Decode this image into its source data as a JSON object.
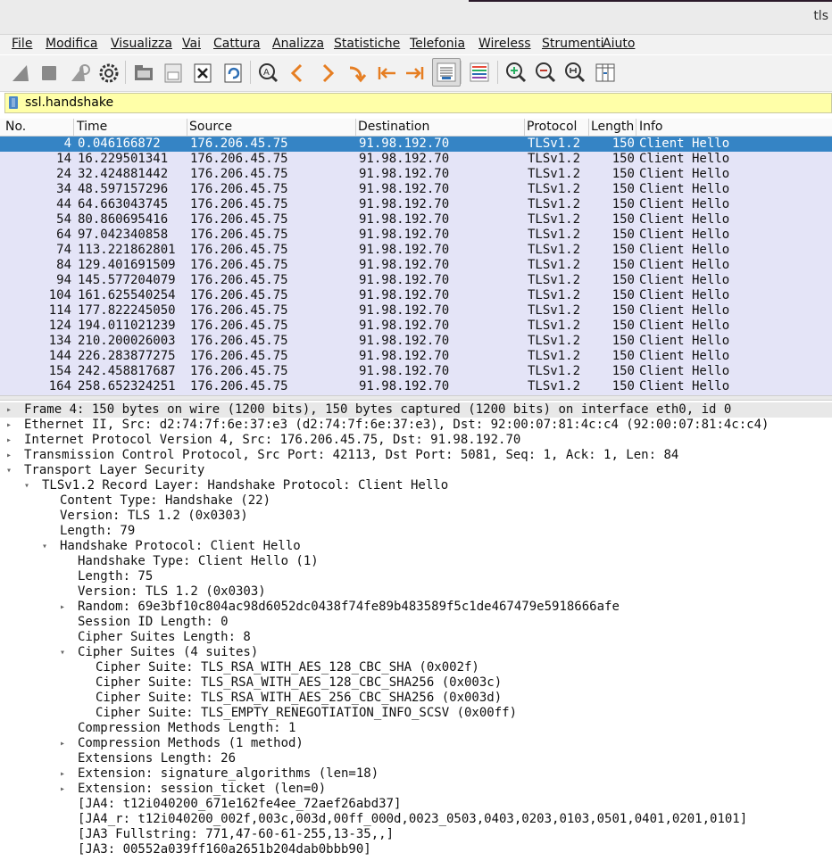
{
  "window": {
    "title": "tls"
  },
  "menu": [
    "File",
    "Modifica",
    "Visualizza",
    "Vai",
    "Cattura",
    "Analizza",
    "Statistiche",
    "Telefonia",
    "Wireless",
    "Strumenti",
    "Aiuto"
  ],
  "toolbar": {
    "icons": [
      "shark-fin-start-icon",
      "stop-square-icon",
      "shark-fin-restart-icon",
      "gear-options-icon",
      "folder-open-icon",
      "file-save-icon",
      "file-close-icon",
      "reload-icon",
      "find-packet-icon",
      "go-back-icon",
      "go-forward-icon",
      "go-to-packet-icon",
      "first-packet-icon",
      "last-packet-icon",
      "autoscroll-icon",
      "colorize-icon",
      "zoom-in-icon",
      "zoom-out-icon",
      "zoom-reset-icon",
      "resize-columns-icon"
    ]
  },
  "filter": {
    "value": "ssl.handshake"
  },
  "packet_list": {
    "columns": [
      "No.",
      "Time",
      "Source",
      "Destination",
      "Protocol",
      "Length",
      "Info"
    ],
    "rows": [
      {
        "no": "4",
        "time": "0.046166872",
        "source": "176.206.45.75",
        "destination": "91.98.192.70",
        "protocol": "TLSv1.2",
        "length": "150",
        "info": "Client Hello"
      },
      {
        "no": "14",
        "time": "16.229501341",
        "source": "176.206.45.75",
        "destination": "91.98.192.70",
        "protocol": "TLSv1.2",
        "length": "150",
        "info": "Client Hello"
      },
      {
        "no": "24",
        "time": "32.424881442",
        "source": "176.206.45.75",
        "destination": "91.98.192.70",
        "protocol": "TLSv1.2",
        "length": "150",
        "info": "Client Hello"
      },
      {
        "no": "34",
        "time": "48.597157296",
        "source": "176.206.45.75",
        "destination": "91.98.192.70",
        "protocol": "TLSv1.2",
        "length": "150",
        "info": "Client Hello"
      },
      {
        "no": "44",
        "time": "64.663043745",
        "source": "176.206.45.75",
        "destination": "91.98.192.70",
        "protocol": "TLSv1.2",
        "length": "150",
        "info": "Client Hello"
      },
      {
        "no": "54",
        "time": "80.860695416",
        "source": "176.206.45.75",
        "destination": "91.98.192.70",
        "protocol": "TLSv1.2",
        "length": "150",
        "info": "Client Hello"
      },
      {
        "no": "64",
        "time": "97.042340858",
        "source": "176.206.45.75",
        "destination": "91.98.192.70",
        "protocol": "TLSv1.2",
        "length": "150",
        "info": "Client Hello"
      },
      {
        "no": "74",
        "time": "113.221862801",
        "source": "176.206.45.75",
        "destination": "91.98.192.70",
        "protocol": "TLSv1.2",
        "length": "150",
        "info": "Client Hello"
      },
      {
        "no": "84",
        "time": "129.401691509",
        "source": "176.206.45.75",
        "destination": "91.98.192.70",
        "protocol": "TLSv1.2",
        "length": "150",
        "info": "Client Hello"
      },
      {
        "no": "94",
        "time": "145.577204079",
        "source": "176.206.45.75",
        "destination": "91.98.192.70",
        "protocol": "TLSv1.2",
        "length": "150",
        "info": "Client Hello"
      },
      {
        "no": "104",
        "time": "161.625540254",
        "source": "176.206.45.75",
        "destination": "91.98.192.70",
        "protocol": "TLSv1.2",
        "length": "150",
        "info": "Client Hello"
      },
      {
        "no": "114",
        "time": "177.822245050",
        "source": "176.206.45.75",
        "destination": "91.98.192.70",
        "protocol": "TLSv1.2",
        "length": "150",
        "info": "Client Hello"
      },
      {
        "no": "124",
        "time": "194.011021239",
        "source": "176.206.45.75",
        "destination": "91.98.192.70",
        "protocol": "TLSv1.2",
        "length": "150",
        "info": "Client Hello"
      },
      {
        "no": "134",
        "time": "210.200026003",
        "source": "176.206.45.75",
        "destination": "91.98.192.70",
        "protocol": "TLSv1.2",
        "length": "150",
        "info": "Client Hello"
      },
      {
        "no": "144",
        "time": "226.283877275",
        "source": "176.206.45.75",
        "destination": "91.98.192.70",
        "protocol": "TLSv1.2",
        "length": "150",
        "info": "Client Hello"
      },
      {
        "no": "154",
        "time": "242.458817687",
        "source": "176.206.45.75",
        "destination": "91.98.192.70",
        "protocol": "TLSv1.2",
        "length": "150",
        "info": "Client Hello"
      },
      {
        "no": "164",
        "time": "258.652324251",
        "source": "176.206.45.75",
        "destination": "91.98.192.70",
        "protocol": "TLSv1.2",
        "length": "150",
        "info": "Client Hello"
      }
    ]
  },
  "details": [
    {
      "indent": 0,
      "arrow": "right",
      "text": "Frame 4: 150 bytes on wire (1200 bits), 150 bytes captured (1200 bits) on interface eth0, id 0",
      "hl": true
    },
    {
      "indent": 0,
      "arrow": "right",
      "text": "Ethernet II, Src: d2:74:7f:6e:37:e3 (d2:74:7f:6e:37:e3), Dst: 92:00:07:81:4c:c4 (92:00:07:81:4c:c4)"
    },
    {
      "indent": 0,
      "arrow": "right",
      "text": "Internet Protocol Version 4, Src: 176.206.45.75, Dst: 91.98.192.70"
    },
    {
      "indent": 0,
      "arrow": "right",
      "text": "Transmission Control Protocol, Src Port: 42113, Dst Port: 5081, Seq: 1, Ack: 1, Len: 84"
    },
    {
      "indent": 0,
      "arrow": "down",
      "text": "Transport Layer Security"
    },
    {
      "indent": 1,
      "arrow": "down",
      "text": "TLSv1.2 Record Layer: Handshake Protocol: Client Hello"
    },
    {
      "indent": 2,
      "arrow": "",
      "text": "Content Type: Handshake (22)"
    },
    {
      "indent": 2,
      "arrow": "",
      "text": "Version: TLS 1.2 (0x0303)"
    },
    {
      "indent": 2,
      "arrow": "",
      "text": "Length: 79"
    },
    {
      "indent": 2,
      "arrow": "down",
      "text": "Handshake Protocol: Client Hello"
    },
    {
      "indent": 3,
      "arrow": "",
      "text": "Handshake Type: Client Hello (1)"
    },
    {
      "indent": 3,
      "arrow": "",
      "text": "Length: 75"
    },
    {
      "indent": 3,
      "arrow": "",
      "text": "Version: TLS 1.2 (0x0303)"
    },
    {
      "indent": 3,
      "arrow": "right",
      "text": "Random: 69e3bf10c804ac98d6052dc0438f74fe89b483589f5c1de467479e5918666afe"
    },
    {
      "indent": 3,
      "arrow": "",
      "text": "Session ID Length: 0"
    },
    {
      "indent": 3,
      "arrow": "",
      "text": "Cipher Suites Length: 8"
    },
    {
      "indent": 3,
      "arrow": "down",
      "text": "Cipher Suites (4 suites)"
    },
    {
      "indent": 4,
      "arrow": "",
      "text": "Cipher Suite: TLS_RSA_WITH_AES_128_CBC_SHA (0x002f)"
    },
    {
      "indent": 4,
      "arrow": "",
      "text": "Cipher Suite: TLS_RSA_WITH_AES_128_CBC_SHA256 (0x003c)"
    },
    {
      "indent": 4,
      "arrow": "",
      "text": "Cipher Suite: TLS_RSA_WITH_AES_256_CBC_SHA256 (0x003d)"
    },
    {
      "indent": 4,
      "arrow": "",
      "text": "Cipher Suite: TLS_EMPTY_RENEGOTIATION_INFO_SCSV (0x00ff)"
    },
    {
      "indent": 3,
      "arrow": "",
      "text": "Compression Methods Length: 1"
    },
    {
      "indent": 3,
      "arrow": "right",
      "text": "Compression Methods (1 method)"
    },
    {
      "indent": 3,
      "arrow": "",
      "text": "Extensions Length: 26"
    },
    {
      "indent": 3,
      "arrow": "right",
      "text": "Extension: signature_algorithms (len=18)"
    },
    {
      "indent": 3,
      "arrow": "right",
      "text": "Extension: session_ticket (len=0)"
    },
    {
      "indent": 3,
      "arrow": "",
      "text": "[JA4: t12i040200_671e162fe4ee_72aef26abd37]"
    },
    {
      "indent": 3,
      "arrow": "",
      "text": "[JA4_r: t12i040200_002f,003c,003d,00ff_000d,0023_0503,0403,0203,0103,0501,0401,0201,0101]"
    },
    {
      "indent": 3,
      "arrow": "",
      "text": "[JA3 Fullstring: 771,47-60-61-255,13-35,,]"
    },
    {
      "indent": 3,
      "arrow": "",
      "text": "[JA3: 00552a039ff160a2651b204dab0bbb90]"
    }
  ]
}
